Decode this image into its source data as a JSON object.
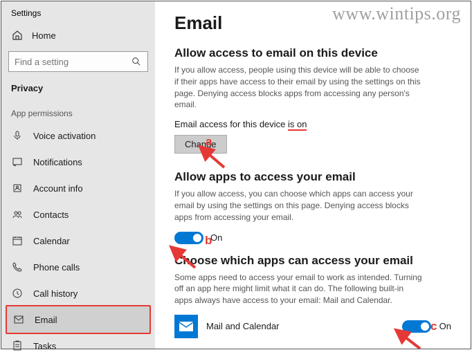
{
  "window_title": "Settings",
  "watermark": "www.wintips.org",
  "sidebar": {
    "home": "Home",
    "search_placeholder": "Find a setting",
    "section": "Privacy",
    "category": "App permissions",
    "items": [
      {
        "label": "Voice activation",
        "icon": "mic-icon"
      },
      {
        "label": "Notifications",
        "icon": "notification-icon"
      },
      {
        "label": "Account info",
        "icon": "account-icon"
      },
      {
        "label": "Contacts",
        "icon": "contacts-icon"
      },
      {
        "label": "Calendar",
        "icon": "calendar-icon"
      },
      {
        "label": "Phone calls",
        "icon": "phone-icon"
      },
      {
        "label": "Call history",
        "icon": "history-icon"
      },
      {
        "label": "Email",
        "icon": "email-icon",
        "selected": true
      },
      {
        "label": "Tasks",
        "icon": "tasks-icon"
      }
    ]
  },
  "main": {
    "title": "Email",
    "section1": {
      "heading": "Allow access to email on this device",
      "desc": "If you allow access, people using this device will be able to choose if their apps have access to their email by using the settings on this page. Denying access blocks apps from accessing any person's email.",
      "status_prefix": "Email access for this device ",
      "status_value": "is on",
      "change_btn": "Change"
    },
    "section2": {
      "heading": "Allow apps to access your email",
      "desc": "If you allow access, you can choose which apps can access your email by using the settings on this page. Denying access blocks apps from accessing your email.",
      "toggle_label": "On"
    },
    "section3": {
      "heading": "Choose which apps can access your email",
      "desc": "Some apps need to access your email to work as intended. Turning off an app here might limit what it can do. The following built-in apps always have access to your email: Mail and Calendar.",
      "apps": [
        {
          "name": "Mail and Calendar",
          "toggle": "On"
        }
      ]
    }
  },
  "annotations": {
    "a": "a",
    "b": "b",
    "c": "c"
  }
}
